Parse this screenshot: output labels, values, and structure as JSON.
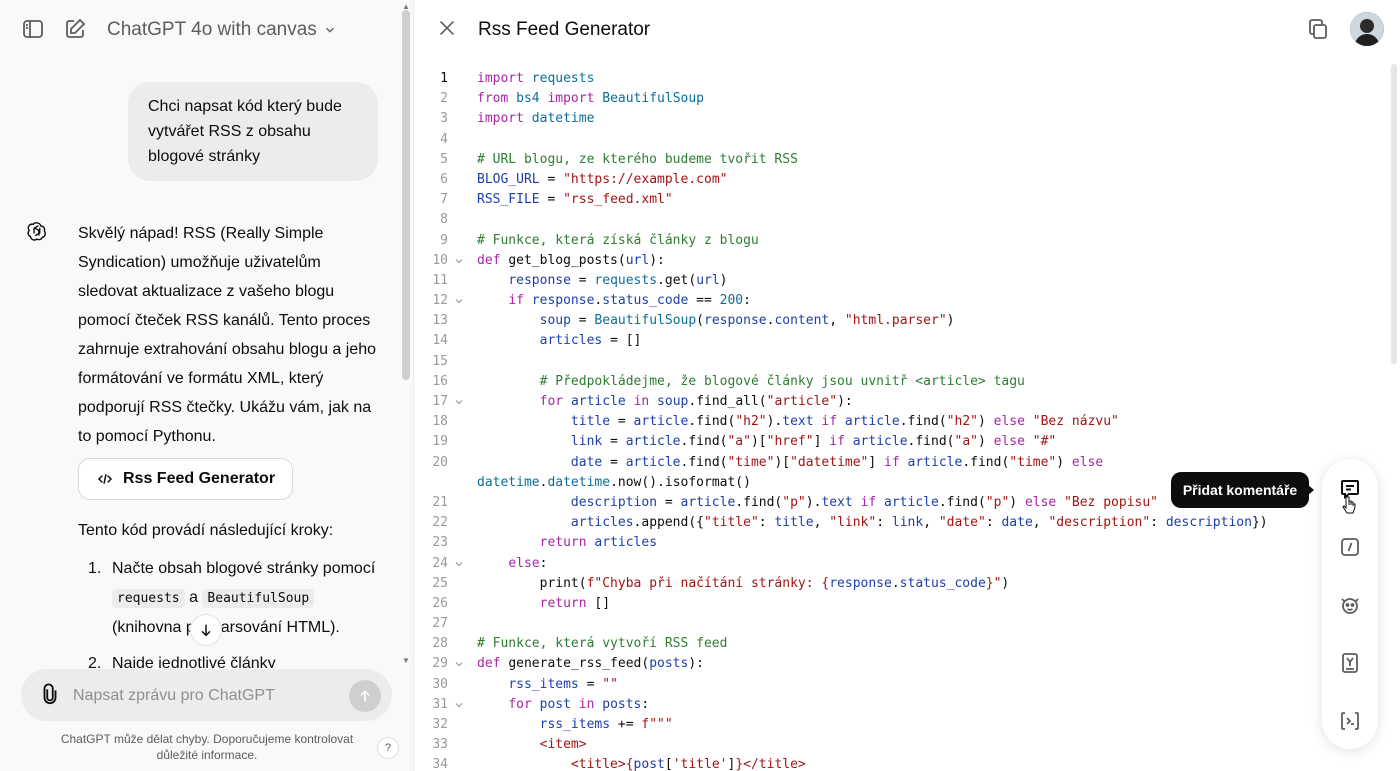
{
  "app": {
    "model_title": "ChatGPT 4o with canvas"
  },
  "chat": {
    "user_message": "Chci napsat kód který bude vytvářet RSS z obsahu blogové stránky",
    "assistant_message": "Skvělý nápad! RSS (Really Simple Syndication) umožňuje uživatelům sledovat aktualizace z vašeho blogu pomocí čteček RSS kanálů. Tento proces zahrnuje extrahování obsahu blogu a jeho formátování ve formátu XML, který podporují RSS čtečky. Ukážu vám, jak na to pomocí Pythonu.",
    "canvas_card_label": "Rss Feed Generator",
    "steps_intro": "Tento kód provádí následující kroky:",
    "step1": {
      "num": "1.",
      "pre": "Načte obsah blogové stránky pomocí ",
      "code1": "requests",
      "mid": " a ",
      "code2": "BeautifulSoup",
      "post": " (knihovna p",
      "post2": "arsování HTML)."
    },
    "step2": {
      "num": "2.",
      "text": "Najde jednotlivé články"
    }
  },
  "composer": {
    "placeholder": "Napsat zprávu pro ChatGPT",
    "disclaimer": "ChatGPT může dělat chyby. Doporučujeme kontrolovat důležité informace.",
    "help": "?"
  },
  "canvas": {
    "title": "Rss Feed Generator",
    "active_line": 1,
    "code_lines": [
      {
        "n": "1",
        "fold": false,
        "html": "<span class=\"kw\">import</span> <span class=\"cls\">requests</span>"
      },
      {
        "n": "2",
        "fold": false,
        "html": "<span class=\"kw\">from</span> <span class=\"cls\">bs4</span> <span class=\"kw\">import</span> <span class=\"cls\">BeautifulSoup</span>"
      },
      {
        "n": "3",
        "fold": false,
        "html": "<span class=\"kw\">import</span> <span class=\"cls\">datetime</span>"
      },
      {
        "n": "4",
        "fold": false,
        "html": ""
      },
      {
        "n": "5",
        "fold": false,
        "html": "<span class=\"com\"># URL blogu, ze kterého budeme tvořit RSS</span>"
      },
      {
        "n": "6",
        "fold": false,
        "html": "<span class=\"var\">BLOG_URL</span> = <span class=\"str\">\"https://example.com\"</span>"
      },
      {
        "n": "7",
        "fold": false,
        "html": "<span class=\"var\">RSS_FILE</span> = <span class=\"str\">\"rss_feed.xml\"</span>"
      },
      {
        "n": "8",
        "fold": false,
        "html": ""
      },
      {
        "n": "9",
        "fold": false,
        "html": "<span class=\"com\"># Funkce, která získá články z blogu</span>"
      },
      {
        "n": "10",
        "fold": true,
        "html": "<span class=\"kw\">def</span> <span class=\"fn\">get_blog_posts</span>(<span class=\"var\">url</span>):"
      },
      {
        "n": "11",
        "fold": false,
        "html": "    <span class=\"var\">response</span> = <span class=\"cls\">requests</span>.get(<span class=\"var\">url</span>)"
      },
      {
        "n": "12",
        "fold": true,
        "html": "    <span class=\"kw\">if</span> <span class=\"var\">response</span>.<span class=\"var\">status_code</span> == <span class=\"num\">200</span>:"
      },
      {
        "n": "13",
        "fold": false,
        "html": "        <span class=\"var\">soup</span> = <span class=\"cls\">BeautifulSoup</span>(<span class=\"var\">response</span>.<span class=\"var\">content</span>, <span class=\"str\">\"html.parser\"</span>)"
      },
      {
        "n": "14",
        "fold": false,
        "html": "        <span class=\"var\">articles</span> = []"
      },
      {
        "n": "15",
        "fold": false,
        "html": ""
      },
      {
        "n": "16",
        "fold": false,
        "html": "        <span class=\"com\"># Předpokládejme, že blogové články jsou uvnitř &lt;article&gt; tagu</span>"
      },
      {
        "n": "17",
        "fold": true,
        "html": "        <span class=\"kw\">for</span> <span class=\"var\">article</span> <span class=\"kw\">in</span> <span class=\"var\">soup</span>.find_all(<span class=\"str\">\"article\"</span>):"
      },
      {
        "n": "18",
        "fold": false,
        "html": "            <span class=\"var\">title</span> = <span class=\"var\">article</span>.find(<span class=\"str\">\"h2\"</span>).<span class=\"var\">text</span> <span class=\"kw\">if</span> <span class=\"var\">article</span>.find(<span class=\"str\">\"h2\"</span>) <span class=\"kw\">else</span> <span class=\"str\">\"Bez názvu\"</span>"
      },
      {
        "n": "19",
        "fold": false,
        "html": "            <span class=\"var\">link</span> = <span class=\"var\">article</span>.find(<span class=\"str\">\"a\"</span>)[<span class=\"str\">\"href\"</span>] <span class=\"kw\">if</span> <span class=\"var\">article</span>.find(<span class=\"str\">\"a\"</span>) <span class=\"kw\">else</span> <span class=\"str\">\"#\"</span>"
      },
      {
        "n": "20",
        "fold": false,
        "html": "            <span class=\"var\">date</span> = <span class=\"var\">article</span>.find(<span class=\"str\">\"time\"</span>)[<span class=\"str\">\"datetime\"</span>] <span class=\"kw\">if</span> <span class=\"var\">article</span>.find(<span class=\"str\">\"time\"</span>) <span class=\"kw\">else</span>"
      },
      {
        "n": "",
        "fold": false,
        "wrap": true,
        "html": "<span class=\"cls\">datetime</span>.<span class=\"cls\">datetime</span>.now().isoformat()"
      },
      {
        "n": "21",
        "fold": false,
        "html": "            <span class=\"var\">description</span> = <span class=\"var\">article</span>.find(<span class=\"str\">\"p\"</span>).<span class=\"var\">text</span> <span class=\"kw\">if</span> <span class=\"var\">article</span>.find(<span class=\"str\">\"p\"</span>) <span class=\"kw\">else</span> <span class=\"str\">\"Bez popisu\"</span>"
      },
      {
        "n": "22",
        "fold": false,
        "html": "            <span class=\"var\">articles</span>.append({<span class=\"str\">\"title\"</span>: <span class=\"var\">title</span>, <span class=\"str\">\"link\"</span>: <span class=\"var\">link</span>, <span class=\"str\">\"date\"</span>: <span class=\"var\">date</span>, <span class=\"str\">\"description\"</span>: <span class=\"var\">description</span>})"
      },
      {
        "n": "23",
        "fold": false,
        "html": "        <span class=\"kw\">return</span> <span class=\"var\">articles</span>"
      },
      {
        "n": "24",
        "fold": true,
        "html": "    <span class=\"kw\">else</span>:"
      },
      {
        "n": "25",
        "fold": false,
        "html": "        print(<span class=\"str\">f\"Chyba při načítání stránky: {</span><span class=\"var\">response</span>.<span class=\"var\">status_code</span><span class=\"str\">}\"</span>)"
      },
      {
        "n": "26",
        "fold": false,
        "html": "        <span class=\"kw\">return</span> []"
      },
      {
        "n": "27",
        "fold": false,
        "html": ""
      },
      {
        "n": "28",
        "fold": false,
        "html": "<span class=\"com\"># Funkce, která vytvoří RSS feed</span>"
      },
      {
        "n": "29",
        "fold": true,
        "html": "<span class=\"kw\">def</span> <span class=\"fn\">generate_rss_feed</span>(<span class=\"var\">posts</span>):"
      },
      {
        "n": "30",
        "fold": false,
        "html": "    <span class=\"var\">rss_items</span> = <span class=\"str\">\"\"</span>"
      },
      {
        "n": "31",
        "fold": true,
        "html": "    <span class=\"kw\">for</span> <span class=\"var\">post</span> <span class=\"kw\">in</span> <span class=\"var\">posts</span>:"
      },
      {
        "n": "32",
        "fold": false,
        "html": "        <span class=\"var\">rss_items</span> += <span class=\"str\">f\"\"\"</span>"
      },
      {
        "n": "33",
        "fold": false,
        "html": "        <span class=\"str\">&lt;item&gt;</span>"
      },
      {
        "n": "34",
        "fold": false,
        "html": "            <span class=\"str\">&lt;title&gt;{</span><span class=\"var\">post</span>[<span class=\"str\">'title'</span>]<span class=\"str\">}&lt;/title&gt;</span>"
      }
    ]
  },
  "toolbar": {
    "tooltip": "Přidat komentáře"
  }
}
